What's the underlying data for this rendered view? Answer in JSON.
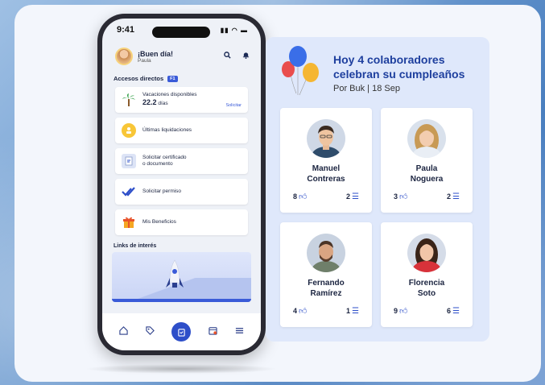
{
  "phone": {
    "time": "9:41",
    "status_icons": "▮▮ ◠ ▬",
    "greeting": "¡Buen día!",
    "user": "Paula",
    "accesos_title": "Accesos directos",
    "accesos_badge": "F1",
    "tiles": [
      {
        "line1": "Vacaciones disponibles",
        "value": "22.2",
        "unit": "días",
        "action": "Solicitar",
        "icon": "palm-tree-icon"
      },
      {
        "line1": "Últimas liquidaciones",
        "icon": "coins-icon"
      },
      {
        "line1": "Solicitar certificado",
        "line2": "o documento",
        "icon": "document-icon"
      },
      {
        "line1": "Solicitar permiso",
        "icon": "checkmarks-icon"
      },
      {
        "line1": "Mis Beneficios",
        "icon": "gift-icon"
      }
    ],
    "links_title": "Links de interés"
  },
  "birthdays": {
    "title": "Hoy 4 colaboradores celebran su cumpleaños",
    "subtitle": "Por Buk | 18 Sep",
    "people": [
      {
        "name1": "Manuel",
        "name2": "Contreras",
        "likes": "8",
        "comments": "2"
      },
      {
        "name1": "Paula",
        "name2": "Noguera",
        "likes": "3",
        "comments": "2"
      },
      {
        "name1": "Fernando",
        "name2": "Ramírez",
        "likes": "4",
        "comments": "1"
      },
      {
        "name1": "Florencia",
        "name2": "Soto",
        "likes": "9",
        "comments": "6"
      }
    ]
  },
  "colors": {
    "accent": "#2e4fc9",
    "title": "#1e3f9e",
    "panel": "#dfe8fb"
  }
}
